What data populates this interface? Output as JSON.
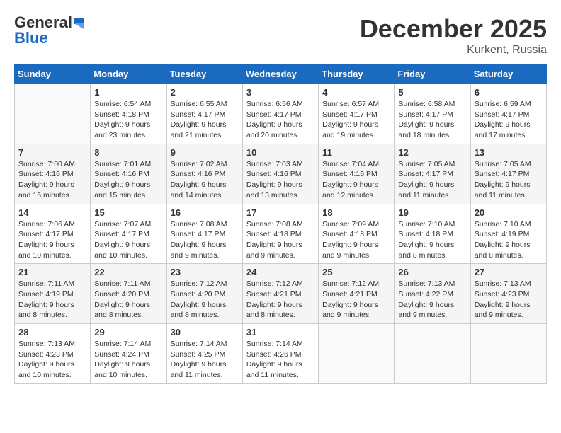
{
  "logo": {
    "line1": "General",
    "line2": "Blue"
  },
  "title": "December 2025",
  "subtitle": "Kurkent, Russia",
  "days_of_week": [
    "Sunday",
    "Monday",
    "Tuesday",
    "Wednesday",
    "Thursday",
    "Friday",
    "Saturday"
  ],
  "weeks": [
    [
      {
        "day": "",
        "info": ""
      },
      {
        "day": "1",
        "info": "Sunrise: 6:54 AM\nSunset: 4:18 PM\nDaylight: 9 hours\nand 23 minutes."
      },
      {
        "day": "2",
        "info": "Sunrise: 6:55 AM\nSunset: 4:17 PM\nDaylight: 9 hours\nand 21 minutes."
      },
      {
        "day": "3",
        "info": "Sunrise: 6:56 AM\nSunset: 4:17 PM\nDaylight: 9 hours\nand 20 minutes."
      },
      {
        "day": "4",
        "info": "Sunrise: 6:57 AM\nSunset: 4:17 PM\nDaylight: 9 hours\nand 19 minutes."
      },
      {
        "day": "5",
        "info": "Sunrise: 6:58 AM\nSunset: 4:17 PM\nDaylight: 9 hours\nand 18 minutes."
      },
      {
        "day": "6",
        "info": "Sunrise: 6:59 AM\nSunset: 4:17 PM\nDaylight: 9 hours\nand 17 minutes."
      }
    ],
    [
      {
        "day": "7",
        "info": "Sunrise: 7:00 AM\nSunset: 4:16 PM\nDaylight: 9 hours\nand 16 minutes."
      },
      {
        "day": "8",
        "info": "Sunrise: 7:01 AM\nSunset: 4:16 PM\nDaylight: 9 hours\nand 15 minutes."
      },
      {
        "day": "9",
        "info": "Sunrise: 7:02 AM\nSunset: 4:16 PM\nDaylight: 9 hours\nand 14 minutes."
      },
      {
        "day": "10",
        "info": "Sunrise: 7:03 AM\nSunset: 4:16 PM\nDaylight: 9 hours\nand 13 minutes."
      },
      {
        "day": "11",
        "info": "Sunrise: 7:04 AM\nSunset: 4:16 PM\nDaylight: 9 hours\nand 12 minutes."
      },
      {
        "day": "12",
        "info": "Sunrise: 7:05 AM\nSunset: 4:17 PM\nDaylight: 9 hours\nand 11 minutes."
      },
      {
        "day": "13",
        "info": "Sunrise: 7:05 AM\nSunset: 4:17 PM\nDaylight: 9 hours\nand 11 minutes."
      }
    ],
    [
      {
        "day": "14",
        "info": "Sunrise: 7:06 AM\nSunset: 4:17 PM\nDaylight: 9 hours\nand 10 minutes."
      },
      {
        "day": "15",
        "info": "Sunrise: 7:07 AM\nSunset: 4:17 PM\nDaylight: 9 hours\nand 10 minutes."
      },
      {
        "day": "16",
        "info": "Sunrise: 7:08 AM\nSunset: 4:17 PM\nDaylight: 9 hours\nand 9 minutes."
      },
      {
        "day": "17",
        "info": "Sunrise: 7:08 AM\nSunset: 4:18 PM\nDaylight: 9 hours\nand 9 minutes."
      },
      {
        "day": "18",
        "info": "Sunrise: 7:09 AM\nSunset: 4:18 PM\nDaylight: 9 hours\nand 9 minutes."
      },
      {
        "day": "19",
        "info": "Sunrise: 7:10 AM\nSunset: 4:18 PM\nDaylight: 9 hours\nand 8 minutes."
      },
      {
        "day": "20",
        "info": "Sunrise: 7:10 AM\nSunset: 4:19 PM\nDaylight: 9 hours\nand 8 minutes."
      }
    ],
    [
      {
        "day": "21",
        "info": "Sunrise: 7:11 AM\nSunset: 4:19 PM\nDaylight: 9 hours\nand 8 minutes."
      },
      {
        "day": "22",
        "info": "Sunrise: 7:11 AM\nSunset: 4:20 PM\nDaylight: 9 hours\nand 8 minutes."
      },
      {
        "day": "23",
        "info": "Sunrise: 7:12 AM\nSunset: 4:20 PM\nDaylight: 9 hours\nand 8 minutes."
      },
      {
        "day": "24",
        "info": "Sunrise: 7:12 AM\nSunset: 4:21 PM\nDaylight: 9 hours\nand 8 minutes."
      },
      {
        "day": "25",
        "info": "Sunrise: 7:12 AM\nSunset: 4:21 PM\nDaylight: 9 hours\nand 9 minutes."
      },
      {
        "day": "26",
        "info": "Sunrise: 7:13 AM\nSunset: 4:22 PM\nDaylight: 9 hours\nand 9 minutes."
      },
      {
        "day": "27",
        "info": "Sunrise: 7:13 AM\nSunset: 4:23 PM\nDaylight: 9 hours\nand 9 minutes."
      }
    ],
    [
      {
        "day": "28",
        "info": "Sunrise: 7:13 AM\nSunset: 4:23 PM\nDaylight: 9 hours\nand 10 minutes."
      },
      {
        "day": "29",
        "info": "Sunrise: 7:14 AM\nSunset: 4:24 PM\nDaylight: 9 hours\nand 10 minutes."
      },
      {
        "day": "30",
        "info": "Sunrise: 7:14 AM\nSunset: 4:25 PM\nDaylight: 9 hours\nand 11 minutes."
      },
      {
        "day": "31",
        "info": "Sunrise: 7:14 AM\nSunset: 4:26 PM\nDaylight: 9 hours\nand 11 minutes."
      },
      {
        "day": "",
        "info": ""
      },
      {
        "day": "",
        "info": ""
      },
      {
        "day": "",
        "info": ""
      }
    ]
  ]
}
